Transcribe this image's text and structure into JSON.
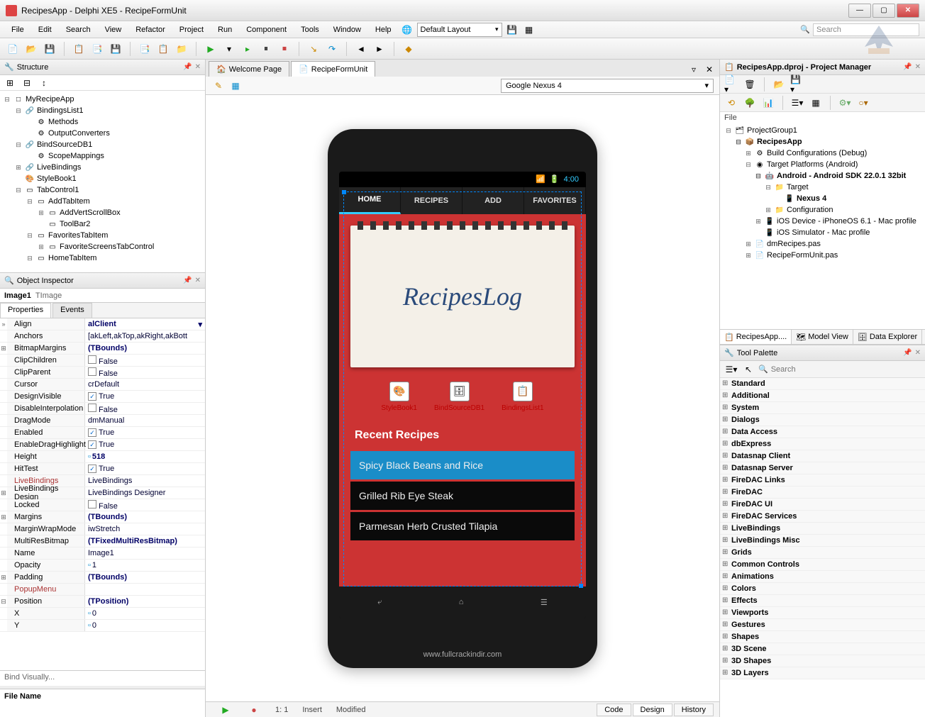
{
  "window": {
    "title": "RecipesApp - Delphi XE5 - RecipeFormUnit"
  },
  "menu": [
    "File",
    "Edit",
    "Search",
    "View",
    "Refactor",
    "Project",
    "Run",
    "Component",
    "Tools",
    "Window",
    "Help"
  ],
  "layout_combo": "Default Layout",
  "search_placeholder": "Search",
  "structure": {
    "title": "Structure",
    "items": [
      {
        "lvl": 0,
        "exp": "⊟",
        "icon": "□",
        "label": "MyRecipeApp"
      },
      {
        "lvl": 1,
        "exp": "⊟",
        "icon": "🔗",
        "label": "BindingsList1"
      },
      {
        "lvl": 2,
        "exp": "",
        "icon": "⚙",
        "label": "Methods"
      },
      {
        "lvl": 2,
        "exp": "",
        "icon": "⚙",
        "label": "OutputConverters"
      },
      {
        "lvl": 1,
        "exp": "⊟",
        "icon": "🔗",
        "label": "BindSourceDB1"
      },
      {
        "lvl": 2,
        "exp": "",
        "icon": "⚙",
        "label": "ScopeMappings"
      },
      {
        "lvl": 1,
        "exp": "⊞",
        "icon": "🔗",
        "label": "LiveBindings"
      },
      {
        "lvl": 1,
        "exp": "",
        "icon": "🎨",
        "label": "StyleBook1"
      },
      {
        "lvl": 1,
        "exp": "⊟",
        "icon": "▭",
        "label": "TabControl1"
      },
      {
        "lvl": 2,
        "exp": "⊟",
        "icon": "▭",
        "label": "AddTabItem"
      },
      {
        "lvl": 3,
        "exp": "⊞",
        "icon": "▭",
        "label": "AddVertScrollBox"
      },
      {
        "lvl": 3,
        "exp": "",
        "icon": "▭",
        "label": "ToolBar2"
      },
      {
        "lvl": 2,
        "exp": "⊟",
        "icon": "▭",
        "label": "FavoritesTabItem"
      },
      {
        "lvl": 3,
        "exp": "⊞",
        "icon": "▭",
        "label": "FavoriteScreensTabControl"
      },
      {
        "lvl": 2,
        "exp": "⊟",
        "icon": "▭",
        "label": "HomeTabItem"
      }
    ]
  },
  "inspector": {
    "title": "Object Inspector",
    "object_name": "Image1",
    "object_class": "TImage",
    "tabs": [
      "Properties",
      "Events"
    ],
    "props": [
      {
        "exp": "»",
        "name": "Align",
        "val": "alClient",
        "bold": true,
        "combo": true
      },
      {
        "exp": "",
        "name": "Anchors",
        "val": "[akLeft,akTop,akRight,akBott"
      },
      {
        "exp": "⊞",
        "name": "BitmapMargins",
        "val": "(TBounds)",
        "bold": true
      },
      {
        "exp": "",
        "name": "ClipChildren",
        "val": "False",
        "check": true
      },
      {
        "exp": "",
        "name": "ClipParent",
        "val": "False",
        "check": true
      },
      {
        "exp": "",
        "name": "Cursor",
        "val": "crDefault"
      },
      {
        "exp": "",
        "name": "DesignVisible",
        "val": "True",
        "check": true,
        "checked": true
      },
      {
        "exp": "",
        "name": "DisableInterpolation",
        "val": "False",
        "check": true
      },
      {
        "exp": "",
        "name": "DragMode",
        "val": "dmManual"
      },
      {
        "exp": "",
        "name": "Enabled",
        "val": "True",
        "check": true,
        "checked": true
      },
      {
        "exp": "",
        "name": "EnableDragHighlight",
        "val": "True",
        "check": true,
        "checked": true
      },
      {
        "exp": "",
        "name": "Height",
        "val": "518",
        "bold": true,
        "numicon": true
      },
      {
        "exp": "",
        "name": "HitTest",
        "val": "True",
        "check": true,
        "checked": true
      },
      {
        "exp": "",
        "name": "LiveBindings",
        "val": "LiveBindings",
        "red": true
      },
      {
        "exp": "⊞",
        "name": "LiveBindings Design",
        "val": "LiveBindings Designer"
      },
      {
        "exp": "",
        "name": "Locked",
        "val": "False",
        "check": true
      },
      {
        "exp": "⊞",
        "name": "Margins",
        "val": "(TBounds)",
        "bold": true
      },
      {
        "exp": "",
        "name": "MarginWrapMode",
        "val": "iwStretch"
      },
      {
        "exp": "",
        "name": "MultiResBitmap",
        "val": "(TFixedMultiResBitmap)",
        "bold": true
      },
      {
        "exp": "",
        "name": "Name",
        "val": "Image1"
      },
      {
        "exp": "",
        "name": "Opacity",
        "val": "1",
        "numicon": true
      },
      {
        "exp": "⊞",
        "name": "Padding",
        "val": "(TBounds)",
        "bold": true
      },
      {
        "exp": "",
        "name": "PopupMenu",
        "val": "",
        "red": true
      },
      {
        "exp": "⊟",
        "name": "Position",
        "val": "(TPosition)",
        "bold": true
      },
      {
        "exp": "",
        "name": "    X",
        "val": "0",
        "numicon": true
      },
      {
        "exp": "",
        "name": "    Y",
        "val": "0",
        "numicon": true
      }
    ],
    "bind_visually": "Bind Visually...",
    "file_name_label": "File Name"
  },
  "designer": {
    "tabs": [
      {
        "icon": "🏠",
        "label": "Welcome Page"
      },
      {
        "icon": "📄",
        "label": "RecipeFormUnit",
        "active": true
      }
    ],
    "device": "Google Nexus 4",
    "phone_time": "4:00",
    "app_tabs": [
      "HOME",
      "RECIPES",
      "ADD",
      "FAVORITES"
    ],
    "logo": "RecipesLog",
    "components": [
      {
        "icon": "🎨",
        "label": "StyleBook1"
      },
      {
        "icon": "🗄",
        "label": "BindSourceDB1"
      },
      {
        "icon": "📋",
        "label": "BindingsList1"
      }
    ],
    "recent_label": "Recent Recipes",
    "recipes": [
      {
        "name": "Spicy Black Beans and Rice",
        "selected": true
      },
      {
        "name": "Grilled Rib Eye Steak"
      },
      {
        "name": "Parmesan Herb Crusted Tilapia"
      }
    ],
    "watermark": "www.fullcrackindir.com",
    "bottom_status": {
      "pos": "1: 1",
      "mode": "Insert",
      "state": "Modified"
    },
    "bottom_tabs": [
      "Code",
      "Design",
      "History"
    ]
  },
  "project_mgr": {
    "title": "RecipesApp.dproj - Project Manager",
    "file_label": "File",
    "tree": [
      {
        "lvl": 0,
        "exp": "⊟",
        "icon": "🗂",
        "label": "ProjectGroup1"
      },
      {
        "lvl": 1,
        "exp": "⊟",
        "icon": "📦",
        "label": "RecipesApp",
        "bold": true
      },
      {
        "lvl": 2,
        "exp": "⊞",
        "icon": "⚙",
        "label": "Build Configurations (Debug)"
      },
      {
        "lvl": 2,
        "exp": "⊟",
        "icon": "◉",
        "label": "Target Platforms (Android)"
      },
      {
        "lvl": 3,
        "exp": "⊟",
        "icon": "🤖",
        "label": "Android - Android SDK 22.0.1 32bit",
        "bold": true
      },
      {
        "lvl": 4,
        "exp": "⊟",
        "icon": "📁",
        "label": "Target"
      },
      {
        "lvl": 5,
        "exp": "",
        "icon": "📱",
        "label": "Nexus 4",
        "bold": true
      },
      {
        "lvl": 4,
        "exp": "⊞",
        "icon": "📁",
        "label": "Configuration"
      },
      {
        "lvl": 3,
        "exp": "⊞",
        "icon": "📱",
        "label": "iOS Device - iPhoneOS 6.1 - Mac profile"
      },
      {
        "lvl": 3,
        "exp": "",
        "icon": "📱",
        "label": "iOS Simulator - Mac profile"
      },
      {
        "lvl": 2,
        "exp": "⊞",
        "icon": "📄",
        "label": "dmRecipes.pas"
      },
      {
        "lvl": 2,
        "exp": "⊞",
        "icon": "📄",
        "label": "RecipeFormUnit.pas"
      }
    ]
  },
  "right_tabs": [
    {
      "label": "RecipesApp....",
      "active": true
    },
    {
      "label": "Model View"
    },
    {
      "label": "Data Explorer"
    }
  ],
  "palette": {
    "title": "Tool Palette",
    "search_placeholder": "Search",
    "categories": [
      "Standard",
      "Additional",
      "System",
      "Dialogs",
      "Data Access",
      "dbExpress",
      "Datasnap Client",
      "Datasnap Server",
      "FireDAC Links",
      "FireDAC",
      "FireDAC UI",
      "FireDAC Services",
      "LiveBindings",
      "LiveBindings Misc",
      "Grids",
      "Common Controls",
      "Animations",
      "Colors",
      "Effects",
      "Viewports",
      "Gestures",
      "Shapes",
      "3D Scene",
      "3D Shapes",
      "3D Layers"
    ]
  }
}
